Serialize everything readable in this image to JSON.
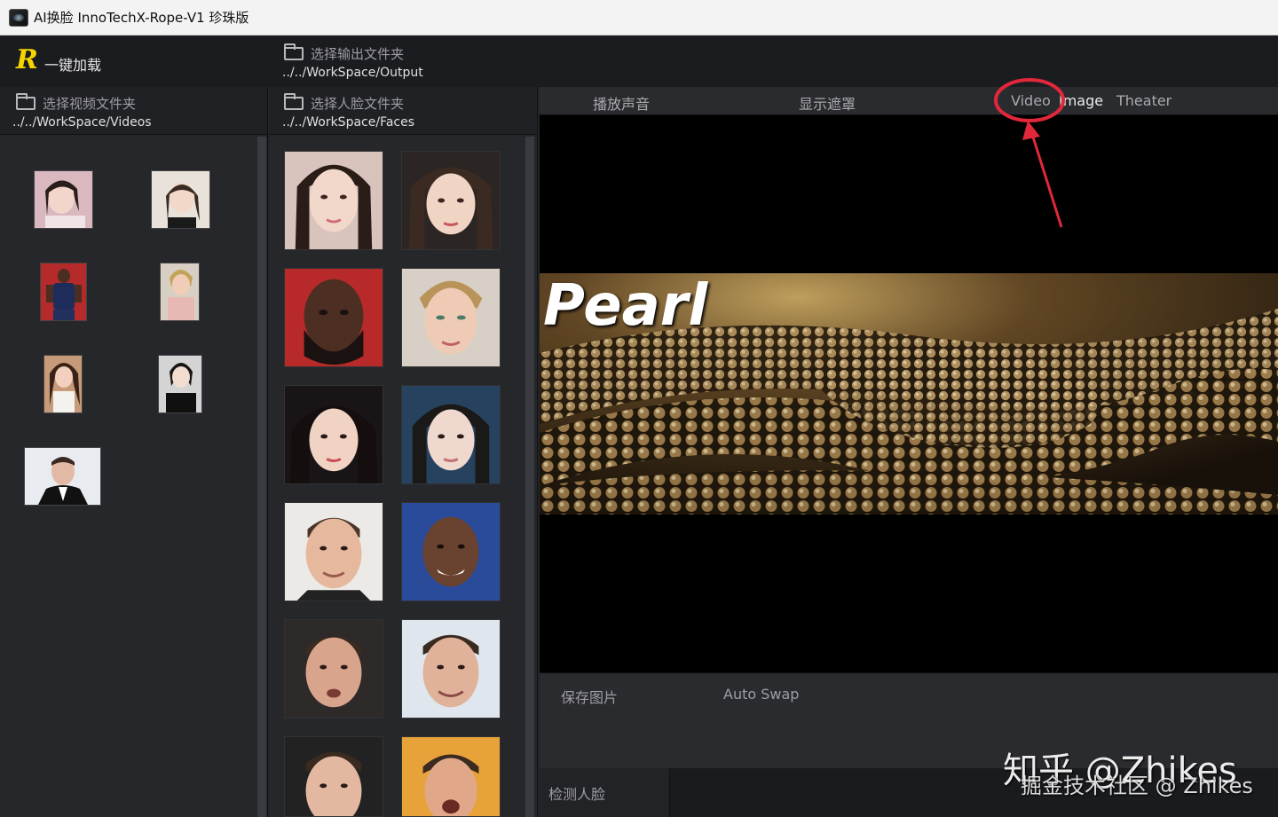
{
  "window": {
    "title": "AI换脸  InnoTechX-Rope-V1 珍珠版"
  },
  "header": {
    "logo": "R",
    "load_label": "一键加载",
    "output_folder": {
      "label": "选择输出文件夹",
      "path": "../../WorkSpace/Output"
    }
  },
  "videos_panel": {
    "folder": {
      "label": "选择视频文件夹",
      "path": "../../WorkSpace/Videos"
    }
  },
  "faces_panel": {
    "folder": {
      "label": "选择人脸文件夹",
      "path": "../../WorkSpace/Faces"
    }
  },
  "main": {
    "tabs": [
      {
        "label": "播放声音"
      },
      {
        "label": "显示遮罩"
      },
      {
        "label": "Video"
      },
      {
        "label": "Image"
      },
      {
        "label": "Theater"
      }
    ],
    "preview_title": "Pearl",
    "bottom": {
      "save_image": "保存图片",
      "auto_swap": "Auto Swap"
    },
    "detect_faces": "检测人脸"
  },
  "watermark": {
    "line1": "知乎 @Zhikes",
    "line2": "掘金技术社区 @ Zhikes"
  },
  "colors": {
    "accent_logo": "#f5d400",
    "annotation_red": "#e0283a"
  }
}
